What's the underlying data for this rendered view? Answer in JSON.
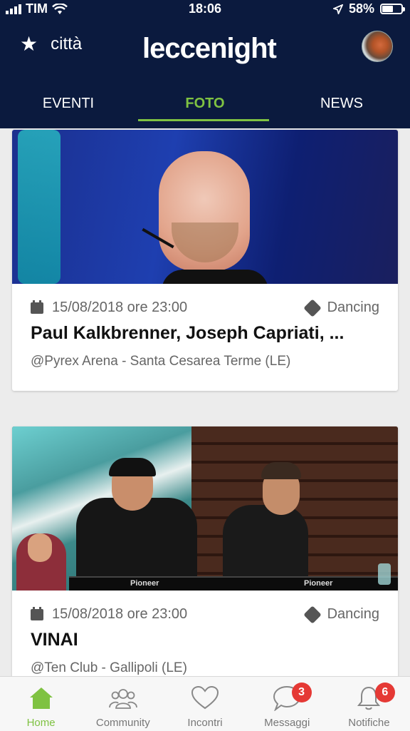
{
  "status_bar": {
    "carrier": "TIM",
    "time": "18:06",
    "battery_percent": "58%",
    "battery_level": 0.58
  },
  "header": {
    "city_label": "città",
    "logo": "leccenight"
  },
  "tabs": [
    {
      "label": "EVENTI",
      "active": false
    },
    {
      "label": "FOTO",
      "active": true
    },
    {
      "label": "NEWS",
      "active": false
    }
  ],
  "cards": [
    {
      "date": "15/08/2018 ore 23:00",
      "category": "Dancing",
      "title": "Paul Kalkbrenner, Joseph Capriati, ...",
      "venue": "@Pyrex Arena - Santa Cesarea Terme (LE)"
    },
    {
      "date": "15/08/2018 ore 23:00",
      "category": "Dancing",
      "title": "VINAI",
      "venue": "@Ten Club - Gallipoli (LE)"
    }
  ],
  "photo_labels": {
    "pioneer_1": "Pioneer",
    "pioneer_2": "Pioneer"
  },
  "bottom_nav": [
    {
      "label": "Home",
      "icon": "home-icon",
      "active": true
    },
    {
      "label": "Community",
      "icon": "community-icon",
      "active": false
    },
    {
      "label": "Incontri",
      "icon": "heart-icon",
      "active": false
    },
    {
      "label": "Messaggi",
      "icon": "chat-bubble-icon",
      "badge": "3",
      "active": false
    },
    {
      "label": "Notifiche",
      "icon": "bell-icon",
      "badge": "6",
      "active": false
    }
  ],
  "colors": {
    "header_bg": "#0b1a3e",
    "accent_green": "#7fc242",
    "badge_red": "#e53935"
  }
}
